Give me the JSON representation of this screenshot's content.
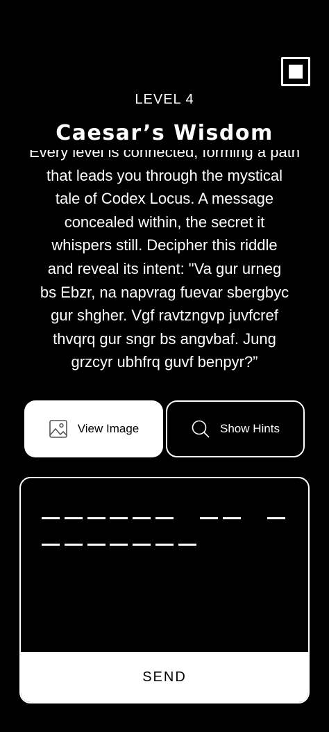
{
  "level": {
    "label": "LEVEL 4"
  },
  "puzzle": {
    "title": "Caesar’s Wisdom",
    "story": "Every level is connected, forming a path\nthat leads you through the mystical\ntale of Codex Locus. A message\nconcealed within, the secret it\nwhispers still. Decipher this riddle\nand reveal its intent: \"Va gur urneg\nbs Ebzr, na napvrag fuevar sbergbyc\ngur shgher. Vgf ravtzngvp juvfcref\nthvqrq gur sngr bs angvbaf. Jung\ngrzcyr ubhfrq guvf benpyr?”"
  },
  "actions": {
    "view_image": {
      "label": "View Image",
      "icon": "image-icon"
    },
    "show_hints": {
      "label": "Show Hints",
      "icon": "search-icon"
    }
  },
  "answer": {
    "word_lengths": [
      6,
      2,
      1,
      7
    ],
    "send_label": "SEND"
  },
  "colors": {
    "background": "#000000",
    "foreground": "#ffffff"
  }
}
